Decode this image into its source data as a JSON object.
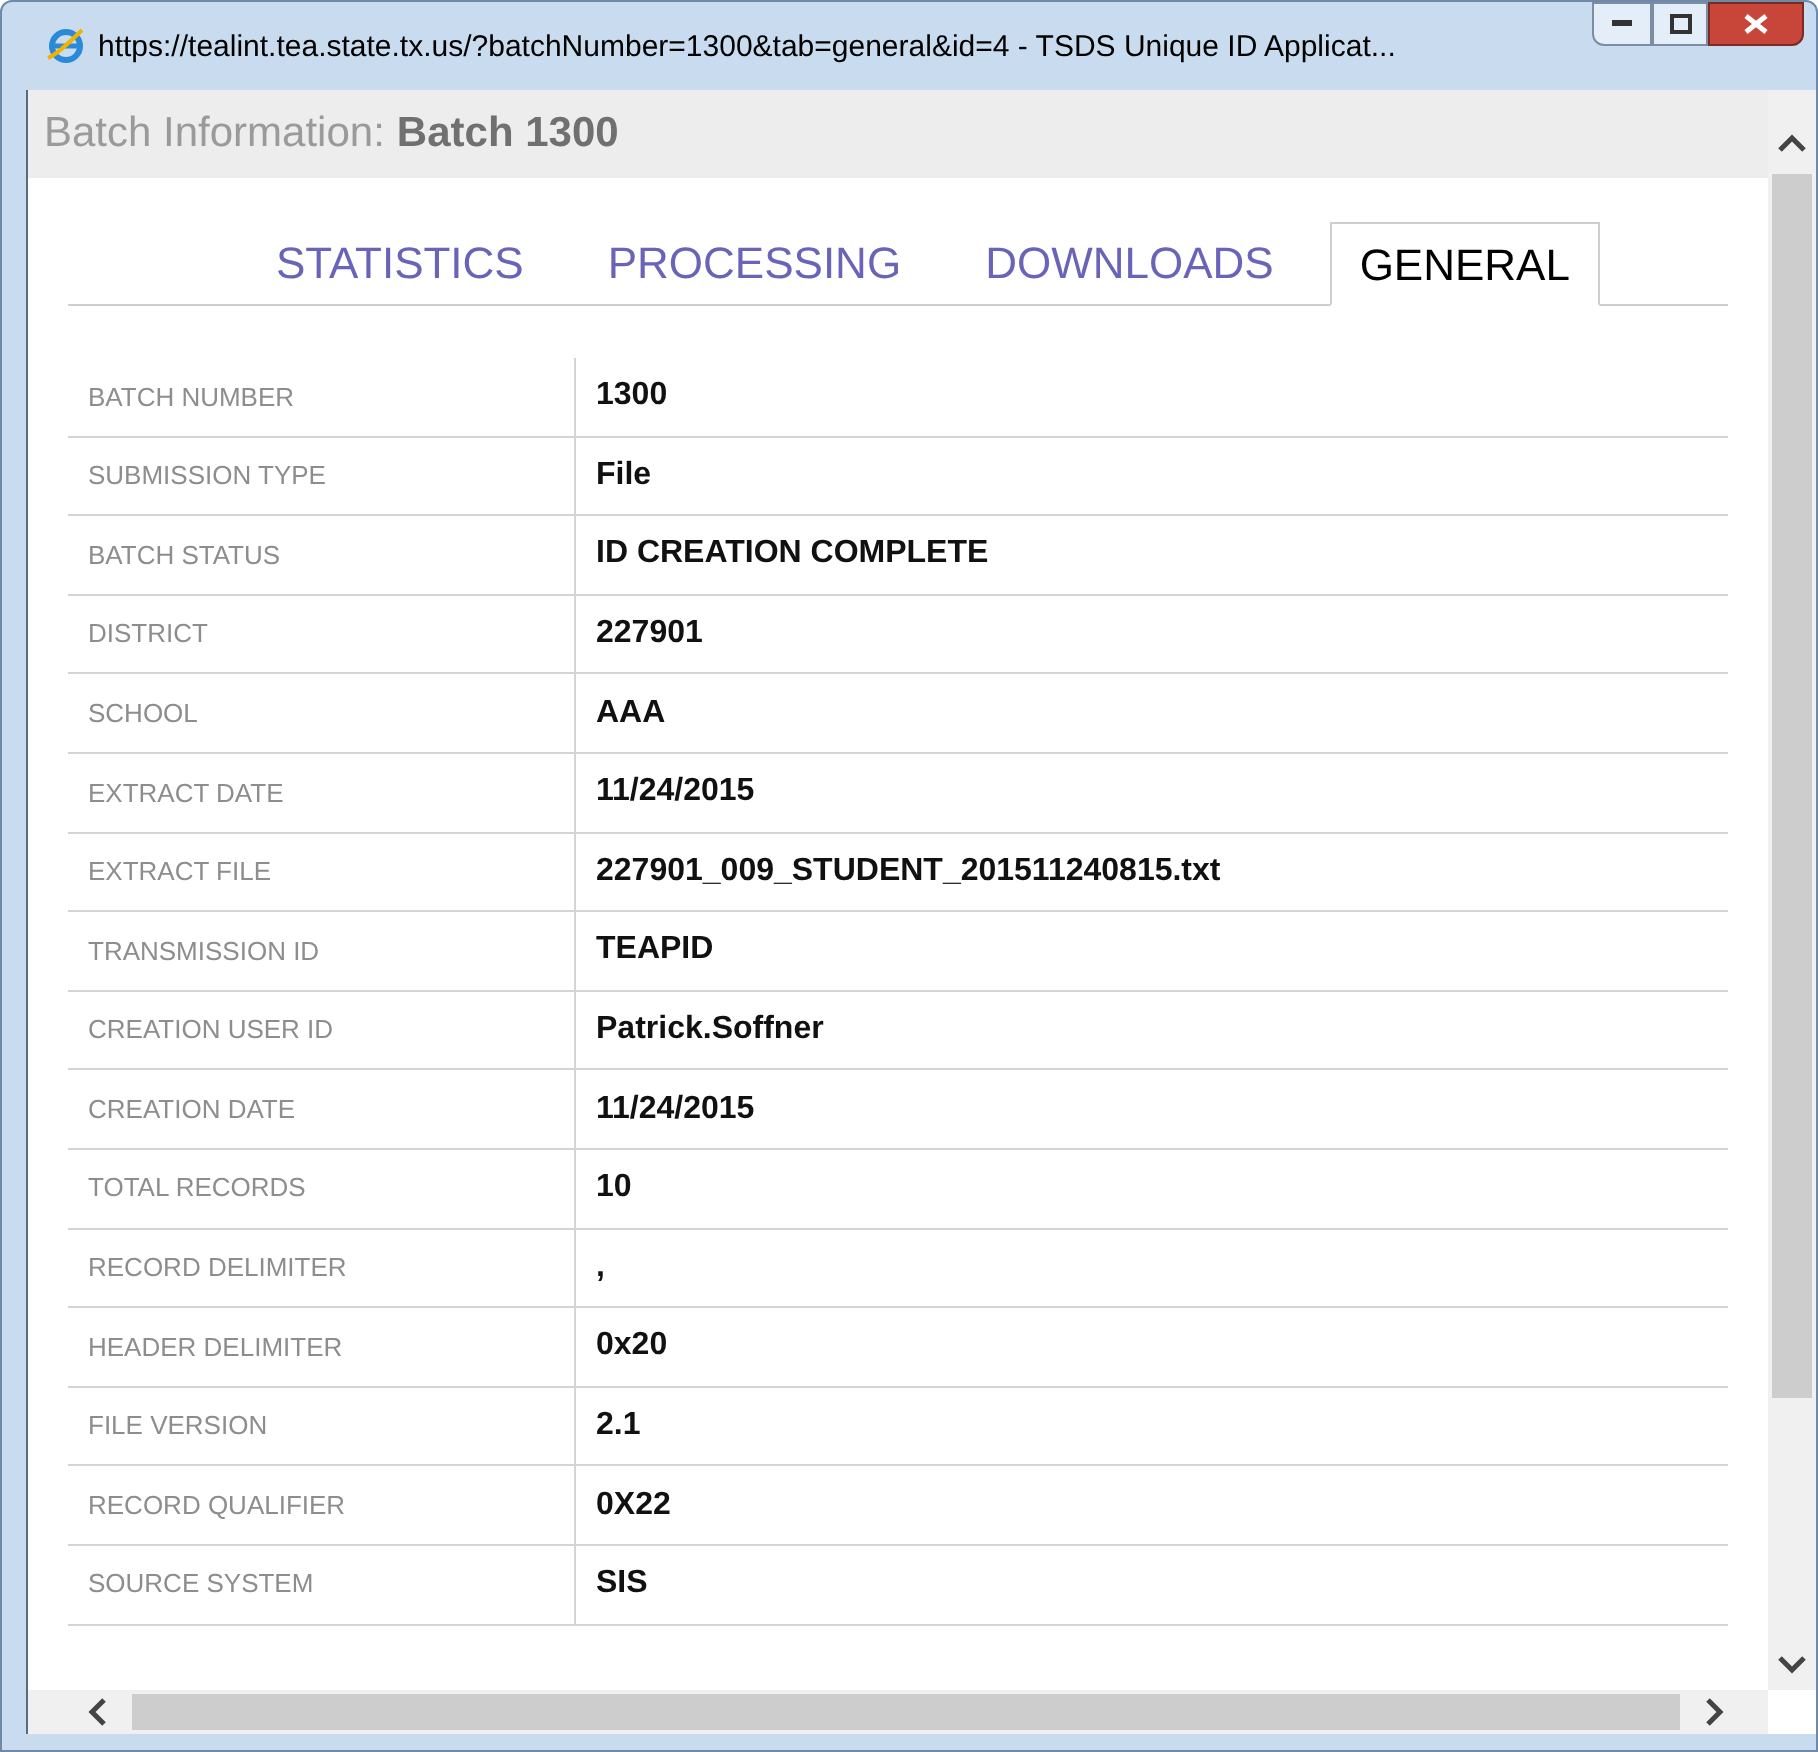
{
  "window": {
    "title": "https://tealint.tea.state.tx.us/?batchNumber=1300&tab=general&id=4 - TSDS Unique ID Applicat..."
  },
  "header": {
    "label": "Batch Information:",
    "value": "Batch 1300"
  },
  "tabs": [
    {
      "label": "STATISTICS",
      "selected": false
    },
    {
      "label": "PROCESSING",
      "selected": false
    },
    {
      "label": "DOWNLOADS",
      "selected": false
    },
    {
      "label": "GENERAL",
      "selected": true
    }
  ],
  "rows": [
    {
      "label": "BATCH NUMBER",
      "value": "1300"
    },
    {
      "label": "SUBMISSION TYPE",
      "value": "File"
    },
    {
      "label": "BATCH STATUS",
      "value": "ID CREATION COMPLETE"
    },
    {
      "label": "DISTRICT",
      "value": "227901"
    },
    {
      "label": "SCHOOL",
      "value": "AAA"
    },
    {
      "label": "EXTRACT DATE",
      "value": "11/24/2015"
    },
    {
      "label": "EXTRACT FILE",
      "value": "227901_009_STUDENT_201511240815.txt"
    },
    {
      "label": "TRANSMISSION ID",
      "value": "TEAPID"
    },
    {
      "label": "CREATION USER ID",
      "value": "Patrick.Soffner"
    },
    {
      "label": "CREATION DATE",
      "value": "11/24/2015"
    },
    {
      "label": "TOTAL RECORDS",
      "value": "10"
    },
    {
      "label": "RECORD DELIMITER",
      "value": ","
    },
    {
      "label": "HEADER DELIMITER",
      "value": "0x20"
    },
    {
      "label": "FILE VERSION",
      "value": "2.1"
    },
    {
      "label": "RECORD QUALIFIER",
      "value": "0X22"
    },
    {
      "label": "SOURCE SYSTEM",
      "value": "SIS"
    }
  ]
}
